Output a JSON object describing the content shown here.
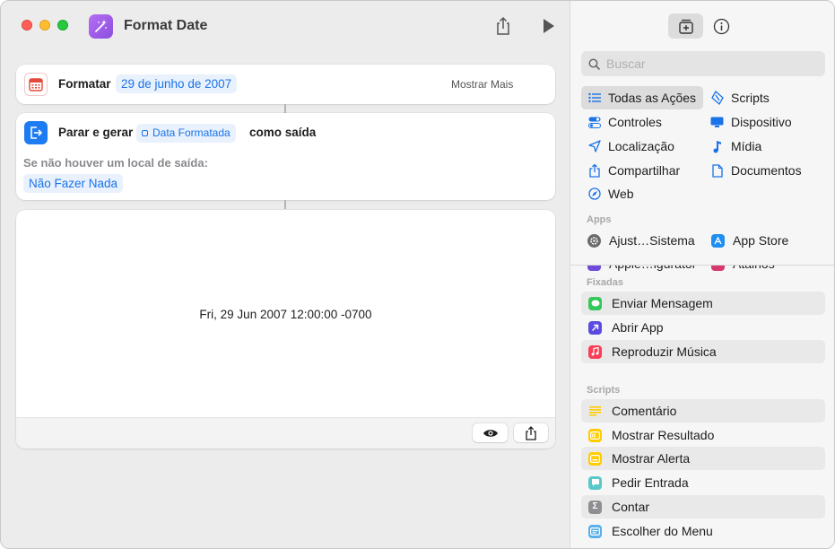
{
  "window": {
    "title": "Format Date"
  },
  "actions": {
    "format": {
      "verb": "Formatar",
      "date_token": "29 de junho de 2007",
      "show_more": "Mostrar Mais"
    },
    "stop_output": {
      "verb": "Parar e gerar",
      "variable": "Data Formatada",
      "suffix": "como saída",
      "fallback_label": "Se não houver um local de saída:",
      "fallback_value": "Não Fazer Nada"
    }
  },
  "result": {
    "text": "Fri, 29 Jun 2007 12:00:00 -0700"
  },
  "library": {
    "search_placeholder": "Buscar",
    "categories_left": [
      "Todas as Ações",
      "Controles",
      "Localização",
      "Compartilhar",
      "Web"
    ],
    "categories_right": [
      "Scripts",
      "Dispositivo",
      "Mídia",
      "Documentos"
    ],
    "apps_label": "Apps",
    "apps": [
      "Ajust…Sistema",
      "App Store",
      "Apple…igurator",
      "Atalhos"
    ],
    "pinned_label": "Fixadas",
    "pinned": [
      "Enviar Mensagem",
      "Abrir App",
      "Reproduzir Música"
    ],
    "scripts_label": "Scripts",
    "scripts": [
      "Comentário",
      "Mostrar Resultado",
      "Mostrar Alerta",
      "Pedir Entrada",
      "Contar",
      "Escolher do Menu"
    ]
  },
  "colors": {
    "accent_blue": "#1a73e8",
    "token_bg": "#e9f1fd",
    "messages_green": "#34c759",
    "open_app_purple": "#5b4be0",
    "music_red": "#fa3e57",
    "script_yellow": "#ffcc00",
    "count_gray": "#8e8e93",
    "menu_blue": "#5ab0e8"
  }
}
